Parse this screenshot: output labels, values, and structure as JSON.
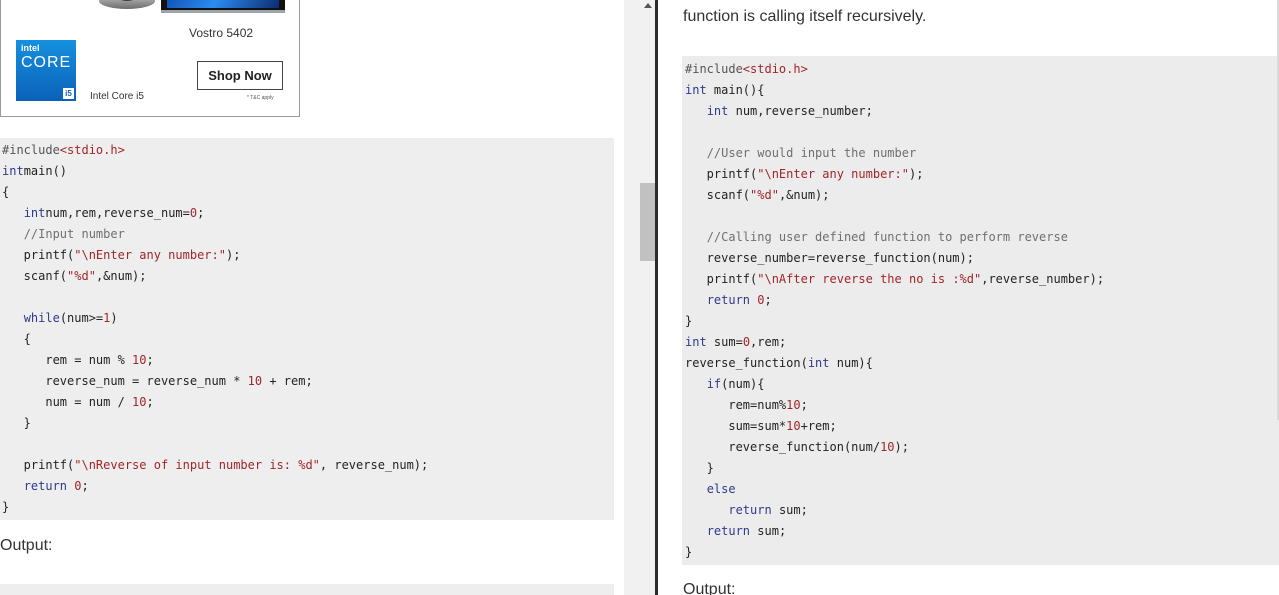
{
  "ad": {
    "model": "Vostro 5402",
    "brand": "intel",
    "chip_name": "CORE",
    "chip_tier": "i5",
    "chip_label": "Intel Core i5",
    "cta": "Shop Now",
    "terms": "* T&C apply"
  },
  "left": {
    "code": [
      [
        [
          "pp",
          "#include"
        ],
        [
          "str",
          "<stdio.h>"
        ]
      ],
      [
        [
          "kw",
          "int"
        ],
        [
          "",
          "main()"
        ]
      ],
      [
        [
          "",
          "{"
        ]
      ],
      [
        [
          "",
          "   "
        ],
        [
          "kw",
          "int"
        ],
        [
          "",
          "num,rem,reverse_num="
        ],
        [
          "num",
          "0"
        ],
        [
          "",
          ";"
        ]
      ],
      [
        [
          "",
          "   "
        ],
        [
          "cm",
          "//Input number"
        ]
      ],
      [
        [
          "",
          "   printf("
        ],
        [
          "str",
          "\"\\nEnter any number:\""
        ],
        [
          "",
          ");"
        ]
      ],
      [
        [
          "",
          "   scanf("
        ],
        [
          "str",
          "\"%d\""
        ],
        [
          "",
          ",&num);"
        ]
      ],
      [
        [
          "",
          ""
        ]
      ],
      [
        [
          "",
          "   "
        ],
        [
          "kw",
          "while"
        ],
        [
          "",
          "(num>="
        ],
        [
          "num",
          "1"
        ],
        [
          "",
          ")"
        ]
      ],
      [
        [
          "",
          "   {"
        ]
      ],
      [
        [
          "",
          "      rem = num % "
        ],
        [
          "num",
          "10"
        ],
        [
          "",
          ";"
        ]
      ],
      [
        [
          "",
          "      reverse_num = reverse_num * "
        ],
        [
          "num",
          "10"
        ],
        [
          "",
          " + rem;"
        ]
      ],
      [
        [
          "",
          "      num = num / "
        ],
        [
          "num",
          "10"
        ],
        [
          "",
          ";"
        ]
      ],
      [
        [
          "",
          "   }"
        ]
      ],
      [
        [
          "",
          ""
        ]
      ],
      [
        [
          "",
          "   printf("
        ],
        [
          "str",
          "\"\\nReverse of input number is: %d\""
        ],
        [
          "",
          ", reverse_num);"
        ]
      ],
      [
        [
          "",
          "   "
        ],
        [
          "kw",
          "return"
        ],
        [
          "",
          " "
        ],
        [
          "num",
          "0"
        ],
        [
          "",
          ";"
        ]
      ],
      [
        [
          "",
          "}"
        ]
      ]
    ],
    "output_heading": "Output:"
  },
  "right": {
    "intro": "function is calling itself recursively.",
    "code": [
      [
        [
          "pp",
          "#include"
        ],
        [
          "str",
          "<stdio.h>"
        ]
      ],
      [
        [
          "kw",
          "int"
        ],
        [
          "",
          " main(){"
        ]
      ],
      [
        [
          "",
          "   "
        ],
        [
          "kw",
          "int"
        ],
        [
          "",
          " num,reverse_number;"
        ]
      ],
      [
        [
          "",
          ""
        ]
      ],
      [
        [
          "",
          "   "
        ],
        [
          "cm",
          "//User would input the number"
        ]
      ],
      [
        [
          "",
          "   printf("
        ],
        [
          "str",
          "\"\\nEnter any number:\""
        ],
        [
          "",
          ");"
        ]
      ],
      [
        [
          "",
          "   scanf("
        ],
        [
          "str",
          "\"%d\""
        ],
        [
          "",
          ",&num);"
        ]
      ],
      [
        [
          "",
          ""
        ]
      ],
      [
        [
          "",
          "   "
        ],
        [
          "cm",
          "//Calling user defined function to perform reverse"
        ]
      ],
      [
        [
          "",
          "   reverse_number=reverse_function(num);"
        ]
      ],
      [
        [
          "",
          "   printf("
        ],
        [
          "str",
          "\"\\nAfter reverse the no is :%d\""
        ],
        [
          "",
          ",reverse_number);"
        ]
      ],
      [
        [
          "",
          "   "
        ],
        [
          "kw",
          "return"
        ],
        [
          "",
          " "
        ],
        [
          "num",
          "0"
        ],
        [
          "",
          ";"
        ]
      ],
      [
        [
          "",
          "}"
        ]
      ],
      [
        [
          "kw",
          "int"
        ],
        [
          "",
          " sum="
        ],
        [
          "num",
          "0"
        ],
        [
          "",
          ",rem;"
        ]
      ],
      [
        [
          "",
          "reverse_function("
        ],
        [
          "kw",
          "int"
        ],
        [
          "",
          " num){"
        ]
      ],
      [
        [
          "",
          "   "
        ],
        [
          "kw",
          "if"
        ],
        [
          "",
          "(num){"
        ]
      ],
      [
        [
          "",
          "      rem=num%"
        ],
        [
          "num",
          "10"
        ],
        [
          "",
          ";"
        ]
      ],
      [
        [
          "",
          "      sum=sum*"
        ],
        [
          "num",
          "10"
        ],
        [
          "",
          "+rem;"
        ]
      ],
      [
        [
          "",
          "      reverse_function(num/"
        ],
        [
          "num",
          "10"
        ],
        [
          "",
          ");"
        ]
      ],
      [
        [
          "",
          "   }"
        ]
      ],
      [
        [
          "",
          "   "
        ],
        [
          "kw",
          "else"
        ]
      ],
      [
        [
          "",
          "      "
        ],
        [
          "kw",
          "return"
        ],
        [
          "",
          " sum;"
        ]
      ],
      [
        [
          "",
          "   "
        ],
        [
          "kw",
          "return"
        ],
        [
          "",
          " sum;"
        ]
      ],
      [
        [
          "",
          "}"
        ]
      ]
    ],
    "output_heading": "Output:"
  },
  "scrollbar": {
    "up_icon": "arrow-up-icon"
  }
}
